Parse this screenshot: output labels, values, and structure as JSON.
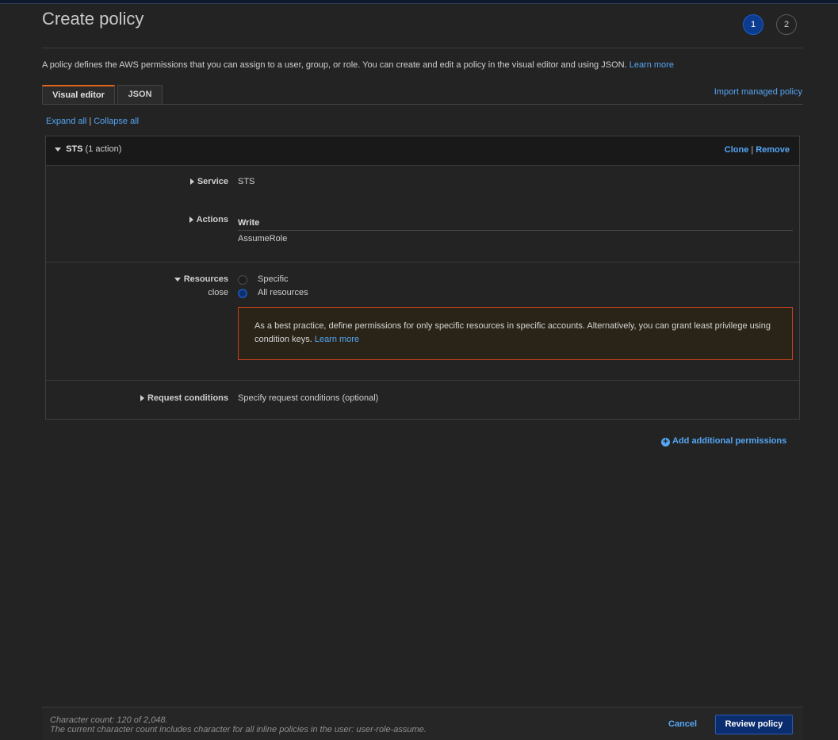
{
  "header": {
    "title": "Create policy",
    "steps": [
      "1",
      "2"
    ],
    "description": "A policy defines the AWS permissions that you can assign to a user, group, or role. You can create and edit a policy in the visual editor and using JSON.",
    "learn_more": "Learn more"
  },
  "tabs": [
    {
      "label": "Visual editor",
      "active": true
    },
    {
      "label": "JSON",
      "active": false
    }
  ],
  "import_link": "Import managed policy",
  "expand_all": "Expand all",
  "separator": "|",
  "collapse_all": "Collapse all",
  "statement": {
    "service_name": "STS",
    "action_count": "(1 action)",
    "clone": "Clone",
    "remove": "Remove",
    "service_label": "Service",
    "service_value": "STS",
    "actions_label": "Actions",
    "actions_group": "Write",
    "actions_value": "AssumeRole",
    "resources_label": "Resources",
    "resources_close": "close",
    "resource_options": [
      {
        "label": "Specific",
        "selected": false
      },
      {
        "label": "All resources",
        "selected": true
      }
    ],
    "warning_text": "As a best practice, define permissions for only specific resources in specific accounts. Alternatively, you can grant least privilege using condition keys.",
    "warning_link": "Learn more",
    "conditions_label": "Request conditions",
    "conditions_link": "Specify request conditions (optional)"
  },
  "add_permissions": "Add additional permissions",
  "footer": {
    "char_count": "Character count: 120 of 2,048.",
    "char_note": "The current character count includes character for all inline policies in the user: user-role-assume.",
    "cancel": "Cancel",
    "review": "Review policy"
  },
  "colors": {
    "accent": "#54a6f4",
    "primary_button": "#0b2c6e",
    "warning_border": "#c7421c",
    "active_tab": "#e0651c"
  }
}
